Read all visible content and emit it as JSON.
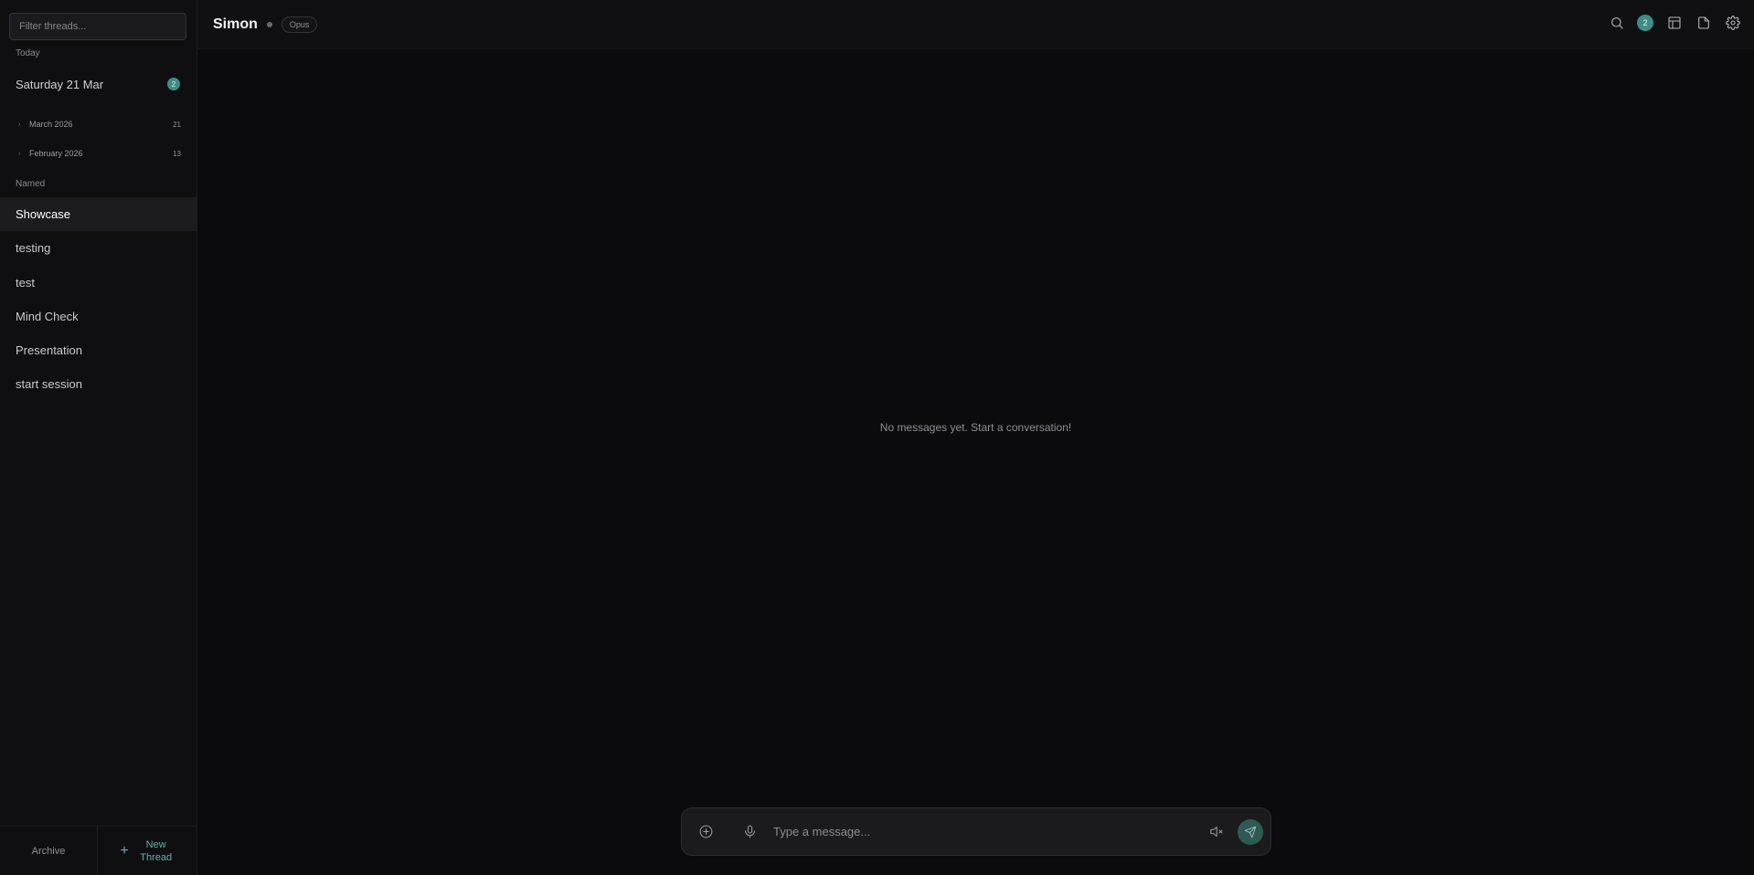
{
  "sidebar": {
    "filter_placeholder": "Filter threads...",
    "today_label": "Today",
    "today_item": {
      "label": "Saturday 21 Mar",
      "badge": "2"
    },
    "months": [
      {
        "label": "March 2026",
        "count": "21"
      },
      {
        "label": "February 2026",
        "count": "13"
      }
    ],
    "named_label": "Named",
    "named_items": [
      {
        "label": "Showcase",
        "active": true
      },
      {
        "label": "testing"
      },
      {
        "label": "test"
      },
      {
        "label": "Mind Check"
      },
      {
        "label": "Presentation"
      },
      {
        "label": "start session"
      }
    ],
    "archive_label": "Archive",
    "new_thread_label": "New Thread"
  },
  "header": {
    "agent_name": "Simon",
    "model": "Opus",
    "notification_count": "2",
    "icons": [
      "search-icon",
      "notification-badge",
      "layout-icon",
      "document-icon",
      "gear-icon"
    ]
  },
  "main": {
    "empty_message": "No messages yet. Start a conversation!"
  },
  "composer": {
    "placeholder": "Type a message...",
    "icons": [
      "add-icon",
      "microphone-icon",
      "mute-icon",
      "send-icon"
    ]
  },
  "colors": {
    "background": "#0b0b0d",
    "sidebar": "#0f0f11",
    "accent": "#3e8d86",
    "accent_text": "#5fb3ab"
  }
}
